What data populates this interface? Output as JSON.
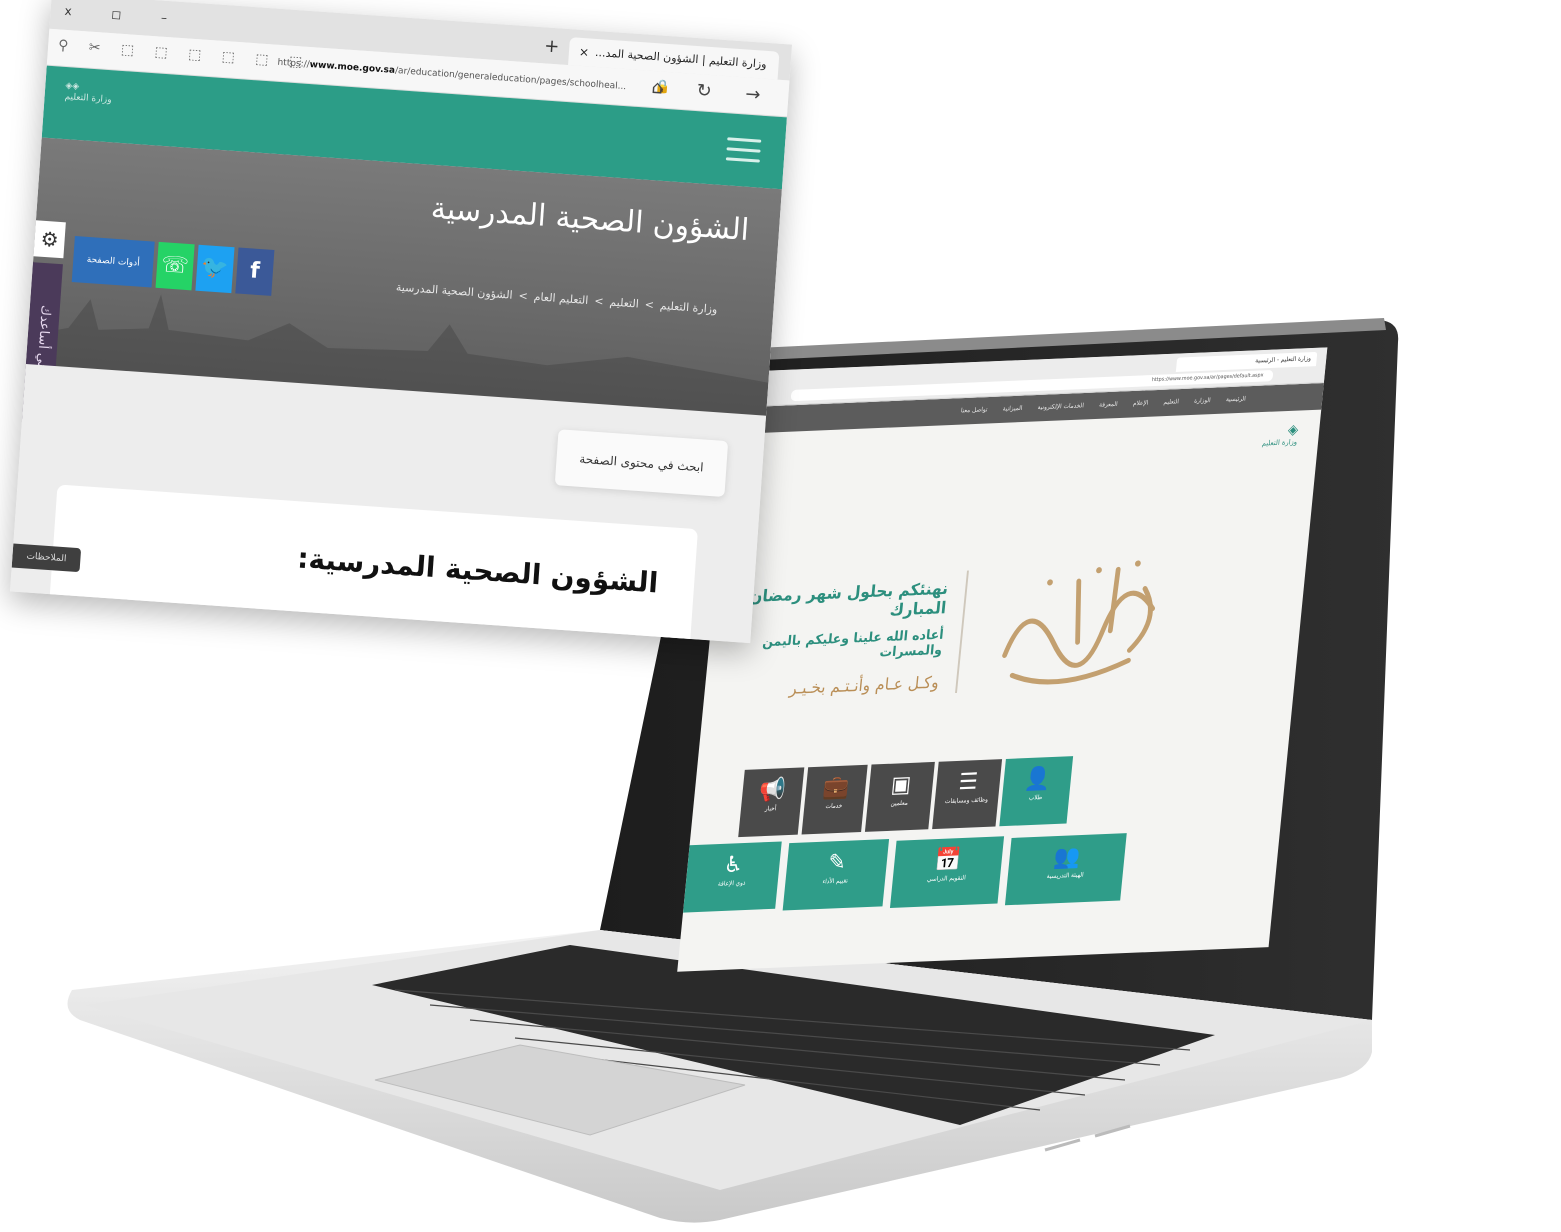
{
  "front_browser": {
    "tab_title": "وزارة التعليم | الشؤون الصحية المد...",
    "tab_close": "×",
    "new_tab": "+",
    "window_controls": "x  ◻  –",
    "url_prefix": "https://",
    "url_domain": "www.moe.gov.sa",
    "url_path": "/ar/education/generaleducation/pages/schoolheal...",
    "extension_icons": "⚲ ✂ ⬚ ⬚ ⬚ ⬚ ⬚ ⬚",
    "nav_icons": "⌂ ↻ →"
  },
  "site": {
    "logo_text": "وزارة التعليم",
    "page_title": "الشؤون الصحية المدرسية",
    "breadcrumb": {
      "item1": "وزارة التعليم",
      "item2": "التعليم",
      "item3": "التعليم العام",
      "item4": "الشؤون الصحية المدرسية",
      "separator": ">"
    },
    "share": {
      "facebook": "f",
      "twitter": "🐦",
      "whatsapp": "☏",
      "tools_label": "أدوات الصفحة"
    },
    "side_help_label": "دعني أساعدك",
    "search_placeholder": "ابحث في محتوى الصفحة",
    "article_title": "الشؤون الصحية المدرسية:",
    "feedback_label": "الملاحظات"
  },
  "laptop_site": {
    "tab_title": "وزارة التعليم - الرئيسية",
    "url": "https://www.moe.gov.sa/ar/pages/default.aspx",
    "nav_items": [
      "الرئيسية",
      "الوزارة",
      "التعليم",
      "الإعلام",
      "المعرفة",
      "الخدمات الإلكترونية",
      "الميزانية",
      "تواصل معنا"
    ],
    "logo": "وزارة التعليم",
    "greeting_line1": "نهنئكم بحلول شهر رمضان المبارك",
    "greeting_line2": "أعاده الله علينا وعليكم باليمن والمسرات",
    "greeting_line3": "وكـل عـام وأنـتـم بخـيـر",
    "calligraphy": "رمضان مبارك",
    "tiles_row1": [
      "أخبار",
      "خدمات",
      "معلمين",
      "وظائف ومسابقات",
      "طلاب"
    ],
    "tiles_row2": [
      "ذوي الإعاقة",
      "تقييم الأداء",
      "التقويم الدراسي",
      "الهيئة التدريسية"
    ],
    "colors": {
      "teal": "#2f9d89",
      "gray": "#4a4a4a",
      "gold": "#b98e56"
    }
  }
}
